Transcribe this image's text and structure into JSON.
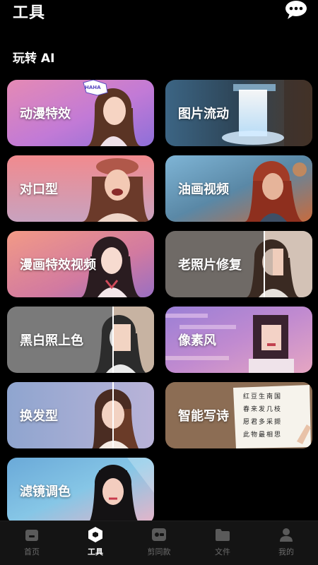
{
  "header": {
    "title": "工具",
    "chat_icon": "chat-bubble-icon"
  },
  "section": {
    "title": "玩转 AI"
  },
  "tools": [
    {
      "label": "动漫特效",
      "sticker": "HAHA"
    },
    {
      "label": "图片流动"
    },
    {
      "label": "对口型"
    },
    {
      "label": "油画视频"
    },
    {
      "label": "漫画特效视频"
    },
    {
      "label": "老照片修复"
    },
    {
      "label": "黑白照上色"
    },
    {
      "label": "像素风"
    },
    {
      "label": "换发型"
    },
    {
      "label": "智能写诗",
      "poem_lines": [
        "红豆生南国",
        "春来发几枝",
        "愿君多采撷",
        "此物最相思"
      ]
    },
    {
      "label": "滤镜调色"
    }
  ],
  "tabbar": {
    "items": [
      {
        "label": "首页",
        "icon": "home-icon",
        "active": false
      },
      {
        "label": "工具",
        "icon": "tools-icon",
        "active": true
      },
      {
        "label": "剪同款",
        "icon": "template-icon",
        "active": false
      },
      {
        "label": "文件",
        "icon": "folder-icon",
        "active": false
      },
      {
        "label": "我的",
        "icon": "profile-icon",
        "active": false
      }
    ]
  },
  "colors": {
    "background": "#000000",
    "tabbar_bg": "#141414",
    "tab_inactive": "#6b6b6b",
    "tab_active": "#ffffff"
  }
}
